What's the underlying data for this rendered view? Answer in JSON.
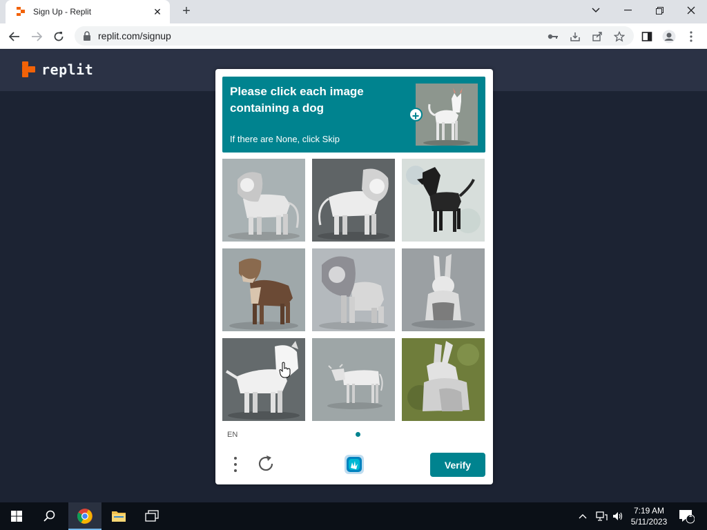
{
  "browser": {
    "tab_title": "Sign Up - Replit",
    "tab_close": "✕",
    "new_tab": "+",
    "url": "replit.com/signup",
    "window": {
      "minimize": "—",
      "restore": "❐",
      "close": "✕",
      "tabsearch": "⌄"
    }
  },
  "page": {
    "logo_text": "replit",
    "brand_color": "#f26207"
  },
  "captcha": {
    "prompt_title": "Please click each image containing a dog",
    "prompt_sub": "If there are None, click Skip",
    "example_image": "white-dog",
    "accent_color": "#00838f",
    "tiles": [
      {
        "subject": "lion"
      },
      {
        "subject": "lion"
      },
      {
        "subject": "black-dog"
      },
      {
        "subject": "brown-dog"
      },
      {
        "subject": "lion"
      },
      {
        "subject": "rabbit"
      },
      {
        "subject": "white-dog"
      },
      {
        "subject": "cow"
      },
      {
        "subject": "rabbit"
      }
    ],
    "language": "EN",
    "verify_label": "Verify"
  },
  "taskbar": {
    "time": "7:19 AM",
    "date": "5/11/2023",
    "notification_count": "1"
  }
}
